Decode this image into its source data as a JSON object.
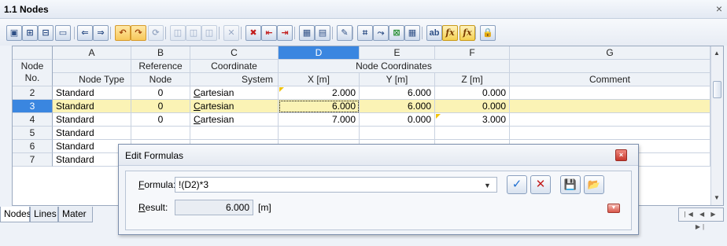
{
  "panel": {
    "title": "1.1 Nodes",
    "close_glyph": "×"
  },
  "toolbar": {
    "buttons": [
      {
        "name": "select-all-icon",
        "glyph": "▣"
      },
      {
        "name": "insert-row-icon",
        "glyph": "⊞"
      },
      {
        "name": "delete-row-icon",
        "glyph": "⊟"
      },
      {
        "name": "clear-icon",
        "glyph": "▭"
      },
      {
        "name": "import-icon",
        "glyph": "⇐"
      },
      {
        "name": "export-icon",
        "glyph": "⇒"
      },
      {
        "name": "undo-icon",
        "glyph": "↶"
      },
      {
        "name": "redo-icon",
        "glyph": "↷"
      },
      {
        "name": "refresh-icon",
        "glyph": "⟳"
      },
      {
        "name": "view-1-icon",
        "glyph": "◫"
      },
      {
        "name": "view-2-icon",
        "glyph": "◫"
      },
      {
        "name": "view-3-icon",
        "glyph": "◫"
      },
      {
        "name": "delete-icon",
        "glyph": "✕"
      },
      {
        "name": "remove-column-icon",
        "glyph": "✖"
      },
      {
        "name": "move-left-icon",
        "glyph": "⇤"
      },
      {
        "name": "move-right-icon",
        "glyph": "⇥"
      },
      {
        "name": "table-view-icon",
        "glyph": "▦"
      },
      {
        "name": "grid-view-icon",
        "glyph": "▤"
      },
      {
        "name": "edit-icon",
        "glyph": "✎"
      },
      {
        "name": "select-in-graphic-icon",
        "glyph": "⌗"
      },
      {
        "name": "go-to-icon",
        "glyph": "⤳"
      },
      {
        "name": "excel-export-icon",
        "glyph": "⊠"
      },
      {
        "name": "calculator-icon",
        "glyph": "▦"
      },
      {
        "name": "text-format-icon",
        "glyph": "ab"
      },
      {
        "name": "formula-icon",
        "glyph": "fx"
      },
      {
        "name": "formula-off-icon",
        "glyph": "fx"
      },
      {
        "name": "lock-icon",
        "glyph": "🔒"
      }
    ]
  },
  "grid": {
    "column_letters": [
      "A",
      "B",
      "C",
      "D",
      "E",
      "F",
      "G"
    ],
    "row_header_title_line1": "Node",
    "row_header_title_line2": "No.",
    "group_headers": {
      "reference": "Reference",
      "coordinate": "Coordinate",
      "node_coordinates": "Node Coordinates"
    },
    "sub_headers": {
      "node_type": "Node Type",
      "reference_node": "Node",
      "coordinate_system": "System",
      "x": "X [m]",
      "y": "Y [m]",
      "z": "Z [m]",
      "comment": "Comment"
    },
    "rows": [
      {
        "no": "2",
        "type": "Standard",
        "ref": "0",
        "system": "Cartesian",
        "x": "2.000",
        "y": "6.000",
        "z": "0.000",
        "comment": ""
      },
      {
        "no": "3",
        "type": "Standard",
        "ref": "0",
        "system": "Cartesian",
        "x": "6.000",
        "y": "6.000",
        "z": "0.000",
        "comment": ""
      },
      {
        "no": "4",
        "type": "Standard",
        "ref": "0",
        "system": "Cartesian",
        "x": "7.000",
        "y": "0.000",
        "z": "3.000",
        "comment": ""
      },
      {
        "no": "5",
        "type": "Standard",
        "ref": "",
        "system": "",
        "x": "",
        "y": "",
        "z": "",
        "comment": ""
      },
      {
        "no": "6",
        "type": "Standard",
        "ref": "",
        "system": "",
        "x": "",
        "y": "",
        "z": "",
        "comment": ""
      },
      {
        "no": "7",
        "type": "Standard",
        "ref": "",
        "system": "",
        "x": "",
        "y": "",
        "z": "",
        "comment": ""
      }
    ],
    "selected_row": "3",
    "selected_column": "D"
  },
  "tabs": [
    "Nodes",
    "Lines",
    "Mater"
  ],
  "dialog": {
    "title": "Edit Formulas",
    "formula_label": "Formula:",
    "formula_value": "!(D2)*3",
    "result_label": "Result:",
    "result_value": "6.000",
    "result_unit": "[m]",
    "ok_glyph": "✓",
    "cancel_glyph": "✕",
    "save_glyph": "💾",
    "open_glyph": "📂",
    "expand_glyph": "▼",
    "close_glyph": "×"
  },
  "colors": {
    "selection_blue": "#3a86e0",
    "selected_row": "#fbf3b5",
    "marker_yellow": "#f1c40f"
  }
}
